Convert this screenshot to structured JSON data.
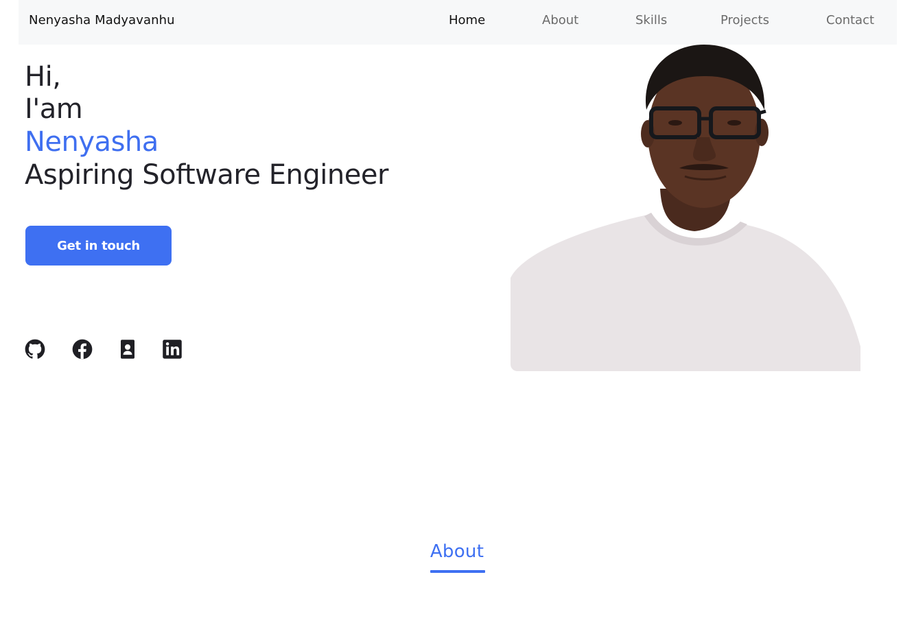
{
  "navbar": {
    "brand": "Nenyasha Madyavanhu",
    "links": [
      "Home",
      "About",
      "Skills",
      "Projects",
      "Contact"
    ],
    "active": "Home"
  },
  "hero": {
    "greeting": "Hi,",
    "intro": "I'am",
    "name": "Nenyasha",
    "role": "Aspiring Software Engineer",
    "cta_label": "Get in touch"
  },
  "social_icons": [
    "github-icon",
    "facebook-icon",
    "contact-card-icon",
    "linkedin-icon"
  ],
  "about_section": {
    "title": "About"
  },
  "colors": {
    "accent": "#3e70f2",
    "text": "#23232a",
    "nav_bg": "#f7f8f9"
  }
}
